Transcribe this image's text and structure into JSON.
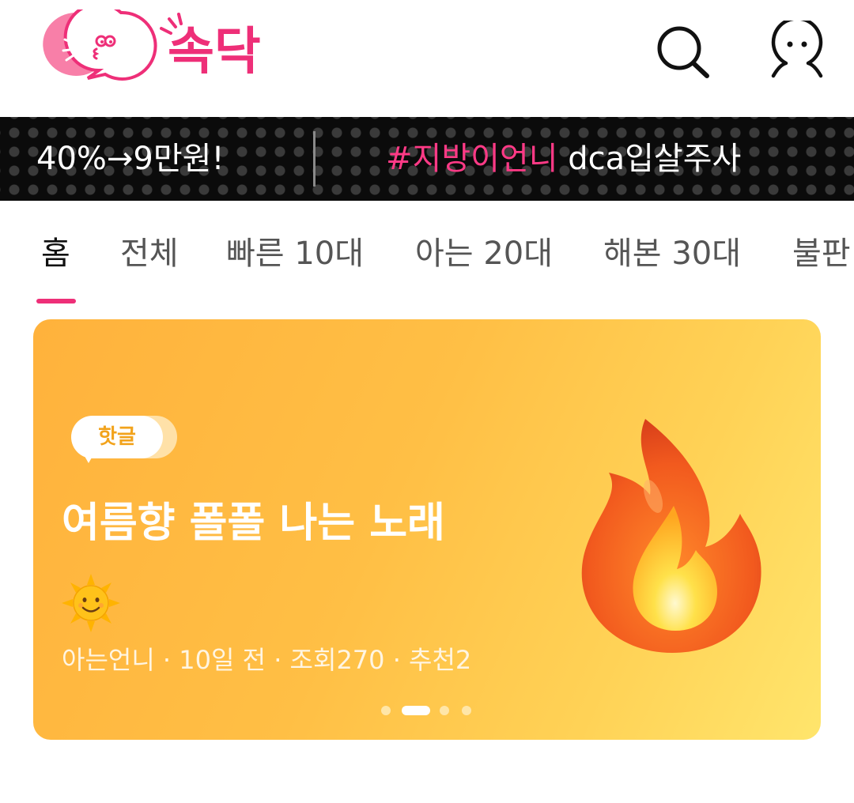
{
  "header": {
    "logo_text": "속닥",
    "search_label": "search",
    "profile_label": "profile"
  },
  "banner": {
    "left_text": "40%→9만원!",
    "right_hashtag": "#지방이언니",
    "right_text": " dca입살주사"
  },
  "tabs": [
    {
      "label": "홈",
      "active": true
    },
    {
      "label": "전체"
    },
    {
      "label": "빠른 10대"
    },
    {
      "label": "아는 20대"
    },
    {
      "label": "해본 30대"
    },
    {
      "label": "불판"
    }
  ],
  "hero": {
    "badge": "핫글",
    "title": "여름향 폴폴 나는 노래",
    "emoji_icon": "sun-with-face-icon",
    "meta": "아는언니 · 10일 전 · 조회270 · 추천2",
    "image_icon": "fire-icon",
    "slides_total": 4,
    "slide_active": 2
  },
  "colors": {
    "brand_pink": "#ee2f78",
    "hashtag_pink": "#ff3a86",
    "hero_orange": "#ffb23c",
    "hero_yellow": "#ffe56c"
  }
}
